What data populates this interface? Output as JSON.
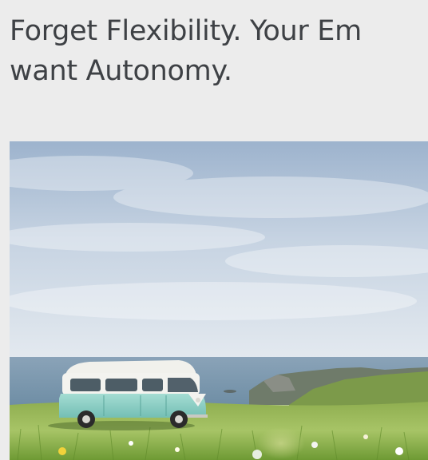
{
  "article": {
    "headline_line1": "Forget Flexibility. Your Em",
    "headline_line2": "want Autonomy."
  },
  "hero_image": {
    "subject": "turquoise-white camper van on grassy clifftop by the sea under cloudy sky",
    "colors": {
      "sky_top": "#9fb4ce",
      "sky_bottom": "#dfe6ee",
      "sea": "#7f9bb0",
      "grass": "#7aa03a",
      "van_body": "#8fd0c6",
      "van_roof": "#f2f2ee"
    }
  }
}
